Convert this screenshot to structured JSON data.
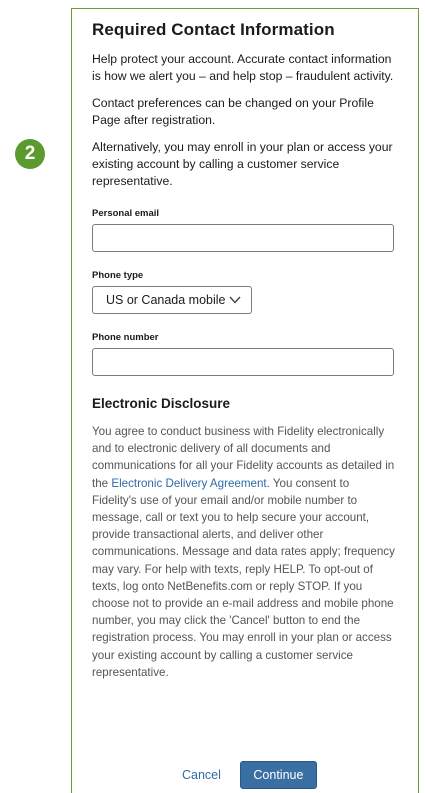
{
  "step_number": "2",
  "title": "Required Contact Information",
  "paragraphs": [
    "Help protect your account. Accurate contact information is how we alert you – and help stop – fraudulent activity.",
    "Contact preferences can be changed on your Profile Page after registration.",
    "Alternatively, you may enroll in your plan or access your existing account by calling a customer service representative."
  ],
  "fields": {
    "personal_email_label": "Personal email",
    "personal_email_value": "",
    "phone_type_label": "Phone type",
    "phone_type_value": "US or Canada mobile",
    "phone_number_label": "Phone number",
    "phone_number_value": ""
  },
  "disclosure": {
    "title": "Electronic Disclosure",
    "text_before_link": "You agree to conduct business with Fidelity electronically and to electronic delivery of all documents and communications for all your Fidelity accounts as detailed in the ",
    "link_text": "Electronic Delivery Agreement",
    "text_after_link": ". You consent to Fidelity's use of your email and/or mobile number to message, call or text you to help secure your account, provide transactional alerts, and deliver other communications. Message and data rates apply; frequency may vary. For help with texts, reply HELP. To opt-out of texts, log onto NetBenefits.com or reply STOP. If you choose not to provide an e-mail address and mobile phone number, you may click the 'Cancel' button to end the registration process. You may enroll in your plan or access your existing account by calling a customer service representative."
  },
  "actions": {
    "cancel_label": "Cancel",
    "continue_label": "Continue"
  },
  "colors": {
    "badge": "#5a9a2e",
    "panel_border": "#6f9a3a",
    "link": "#2f6ba8",
    "primary_button": "#3a6fa3"
  }
}
